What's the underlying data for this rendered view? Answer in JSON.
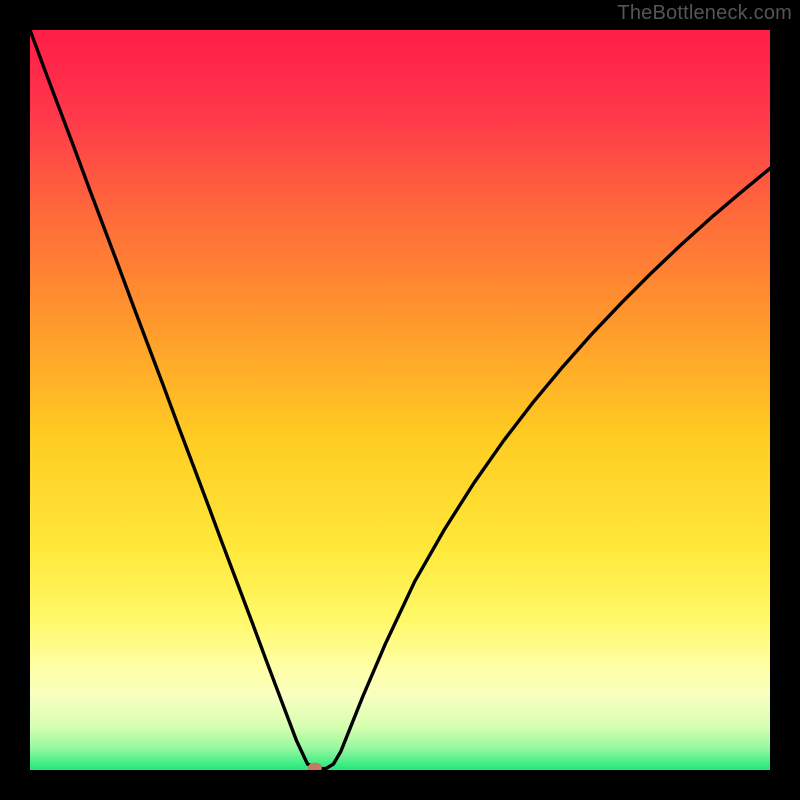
{
  "attribution": "TheBottleneck.com",
  "chart_data": {
    "type": "line",
    "title": "",
    "xlabel": "",
    "ylabel": "",
    "xlim": [
      0,
      100
    ],
    "ylim": [
      0,
      100
    ],
    "background_gradient": {
      "stops": [
        {
          "offset": 0.0,
          "color": "#ff1f47"
        },
        {
          "offset": 0.06,
          "color": "#ff2a4a"
        },
        {
          "offset": 0.12,
          "color": "#ff3a4a"
        },
        {
          "offset": 0.25,
          "color": "#ff6a3a"
        },
        {
          "offset": 0.4,
          "color": "#ff9a2c"
        },
        {
          "offset": 0.55,
          "color": "#ffcc22"
        },
        {
          "offset": 0.7,
          "color": "#ffe83a"
        },
        {
          "offset": 0.8,
          "color": "#fff96a"
        },
        {
          "offset": 0.86,
          "color": "#ffffa5"
        },
        {
          "offset": 0.9,
          "color": "#f8ffc0"
        },
        {
          "offset": 0.94,
          "color": "#d8ffb0"
        },
        {
          "offset": 0.97,
          "color": "#98f8a0"
        },
        {
          "offset": 1.0,
          "color": "#20e87a"
        }
      ]
    },
    "curve": {
      "x": [
        0,
        2,
        4,
        6,
        8,
        10,
        12,
        14,
        16,
        18,
        20,
        22,
        24,
        26,
        28,
        30,
        32,
        34,
        36,
        37.5,
        39,
        40,
        41,
        42,
        43,
        45,
        48,
        52,
        56,
        60,
        64,
        68,
        72,
        76,
        80,
        84,
        88,
        92,
        96,
        100
      ],
      "y": [
        100,
        94.6,
        89.3,
        84.0,
        78.6,
        73.3,
        68.0,
        62.6,
        57.3,
        52.0,
        46.6,
        41.3,
        36.0,
        30.6,
        25.3,
        20.0,
        14.6,
        9.3,
        4.0,
        0.8,
        0.2,
        0.2,
        0.8,
        2.5,
        5.0,
        10.0,
        17.0,
        25.5,
        32.5,
        38.8,
        44.5,
        49.7,
        54.5,
        59.0,
        63.2,
        67.2,
        71.0,
        74.6,
        78.0,
        81.3
      ]
    },
    "marker": {
      "x": 38.5,
      "y": 0.3,
      "color": "#c47a64"
    }
  }
}
